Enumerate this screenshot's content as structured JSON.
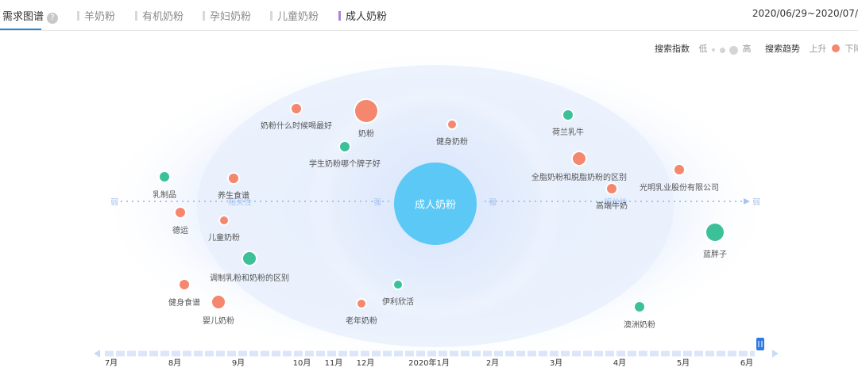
{
  "header": {
    "title": "需求图谱",
    "help_icon": "question-circle-icon",
    "tabs": [
      {
        "label": "羊奶粉",
        "active": false
      },
      {
        "label": "有机奶粉",
        "active": false
      },
      {
        "label": "孕妇奶粉",
        "active": false
      },
      {
        "label": "儿童奶粉",
        "active": false
      },
      {
        "label": "成人奶粉",
        "active": true
      }
    ],
    "date_range": "2020/06/29~2020/07/"
  },
  "legend": {
    "index_label": "搜索指数",
    "low": "低",
    "high": "高",
    "trend_label": "搜索趋势",
    "up": "上升",
    "down": "下降"
  },
  "colors": {
    "rise": "#f4876e",
    "fall": "#3cc098",
    "center": "#5bc8f5",
    "accent": "#1e88e5",
    "active_tab_bar": "#b083d6"
  },
  "graph": {
    "center": "成人奶粉",
    "axis_words": {
      "weak_left": "弱",
      "strong_left": "强",
      "strong_right": "强",
      "weak_right": "弱",
      "relevance": "相关性"
    },
    "keywords": [
      {
        "label": "奶粉什么时候喝最好",
        "trend": "up"
      },
      {
        "label": "奶粉",
        "trend": "up"
      },
      {
        "label": "健身奶粉",
        "trend": "up"
      },
      {
        "label": "荷兰乳牛",
        "trend": "down"
      },
      {
        "label": "学生奶粉哪个牌子好",
        "trend": "down"
      },
      {
        "label": "全脂奶粉和脱脂奶粉的区别",
        "trend": "up"
      },
      {
        "label": "乳制品",
        "trend": "down"
      },
      {
        "label": "养生食谱",
        "trend": "up"
      },
      {
        "label": "光明乳业股份有限公司",
        "trend": "up"
      },
      {
        "label": "高端牛奶",
        "trend": "up"
      },
      {
        "label": "德运",
        "trend": "up"
      },
      {
        "label": "儿童奶粉",
        "trend": "up"
      },
      {
        "label": "蓝胖子",
        "trend": "down"
      },
      {
        "label": "调制乳粉和奶粉的区别",
        "trend": "down"
      },
      {
        "label": "伊利欣活",
        "trend": "down"
      },
      {
        "label": "健身食谱",
        "trend": "up"
      },
      {
        "label": "婴儿奶粉",
        "trend": "up"
      },
      {
        "label": "老年奶粉",
        "trend": "up"
      },
      {
        "label": "澳洲奶粉",
        "trend": "down"
      }
    ]
  },
  "timeline": {
    "months": [
      "7月",
      "8月",
      "9月",
      "10月",
      "11月",
      "12月",
      "2020年1月",
      "2月",
      "3月",
      "4月",
      "5月",
      "6月"
    ]
  }
}
